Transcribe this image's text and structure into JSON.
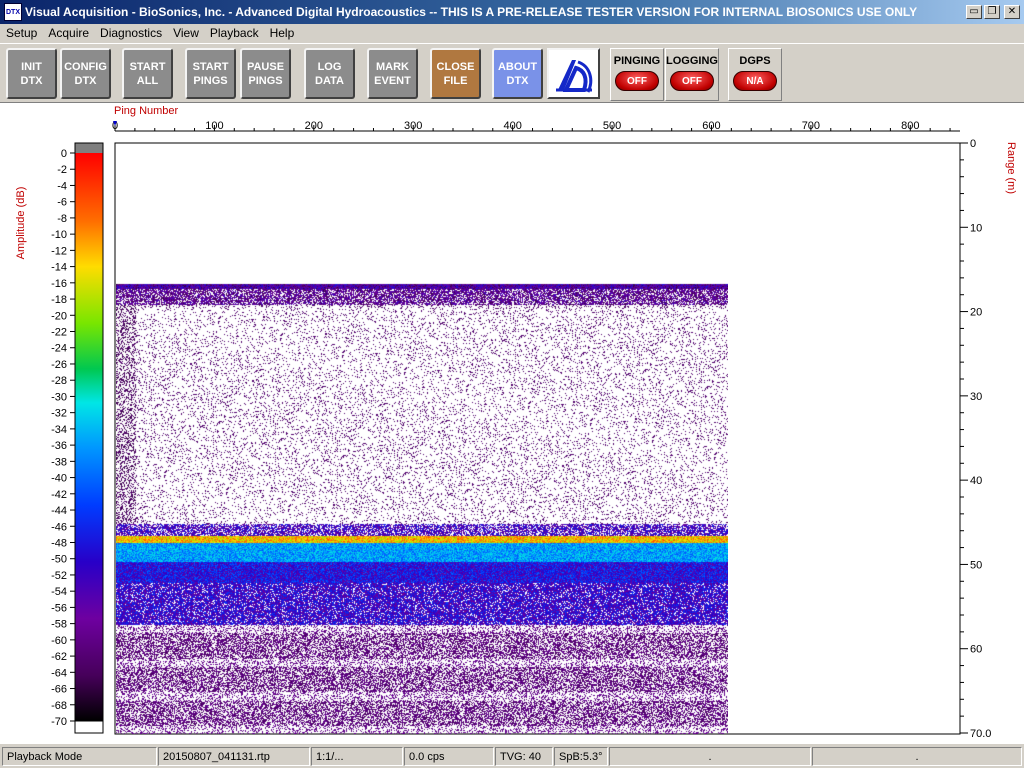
{
  "window": {
    "app_icon": "DTX",
    "title": "Visual Acquisition  -  BioSonics, Inc.  -  Advanced Digital Hydroacoustics  -- THIS IS A PRE-RELEASE TESTER VERSION FOR INTERNAL BIOSONICS USE ONLY",
    "controls": {
      "minimize": "▭",
      "restore": "❐",
      "close": "✕"
    }
  },
  "menu": [
    "Setup",
    "Acquire",
    "Diagnostics",
    "View",
    "Playback",
    "Help"
  ],
  "toolbar": {
    "buttons": [
      {
        "id": "init-dtx",
        "line1": "INIT",
        "line2": "DTX",
        "style": "gray"
      },
      {
        "id": "config-dtx",
        "line1": "CONFIG",
        "line2": "DTX",
        "style": "gray"
      },
      {
        "id": "start-all",
        "line1": "START",
        "line2": "ALL",
        "style": "gray"
      },
      {
        "id": "start-pings",
        "line1": "START",
        "line2": "PINGS",
        "style": "gray"
      },
      {
        "id": "pause-pings",
        "line1": "PAUSE",
        "line2": "PINGS",
        "style": "gray"
      },
      {
        "id": "log-data",
        "line1": "LOG",
        "line2": "DATA",
        "style": "gray"
      },
      {
        "id": "mark-event",
        "line1": "MARK",
        "line2": "EVENT",
        "style": "gray"
      },
      {
        "id": "close-file",
        "line1": "CLOSE",
        "line2": "FILE",
        "style": "copper"
      },
      {
        "id": "about-dtx",
        "line1": "ABOUT",
        "line2": "DTX",
        "style": "blue"
      }
    ],
    "status": [
      {
        "id": "pinging",
        "label": "PINGING",
        "value": "OFF"
      },
      {
        "id": "logging",
        "label": "LOGGING",
        "value": "OFF"
      },
      {
        "id": "dgps",
        "label": "DGPS",
        "value": "N/A"
      }
    ],
    "logo_icon": "biosonics-logo-icon"
  },
  "echogram": {
    "ping_axis_label": "Ping Number",
    "ping_ticks": [
      "0",
      "100",
      "200",
      "300",
      "400",
      "500",
      "600",
      "700",
      "800"
    ],
    "ping_range": [
      0,
      850
    ],
    "pings_recorded": 612,
    "range_axis_label": "Range (m)",
    "range_ticks": [
      "0",
      "10",
      "20",
      "30",
      "40",
      "50",
      "60",
      "70.0"
    ],
    "range_max_m": 70,
    "amplitude_label": "Amplitude (dB)",
    "amplitude_ticks": [
      "0",
      "-2",
      "-4",
      "-6",
      "-8",
      "-10",
      "-12",
      "-14",
      "-16",
      "-18",
      "-20",
      "-22",
      "-24",
      "-26",
      "-28",
      "-30",
      "-32",
      "-34",
      "-36",
      "-38",
      "-40",
      "-42",
      "-44",
      "-46",
      "-48",
      "-50",
      "-52",
      "-54",
      "-56",
      "-58",
      "-60",
      "-62",
      "-64",
      "-66",
      "-68",
      "-70"
    ],
    "colors": {
      "axis_label": "#c00000"
    }
  },
  "statusbar": {
    "mode": "Playback Mode",
    "file": "20150807_041131.rtp",
    "ratio": "1:1/...",
    "rate": "0.0 cps",
    "tvg": "TVG: 40",
    "spb": "SpB:5.3°",
    "cell7": ".",
    "cell8": "."
  }
}
